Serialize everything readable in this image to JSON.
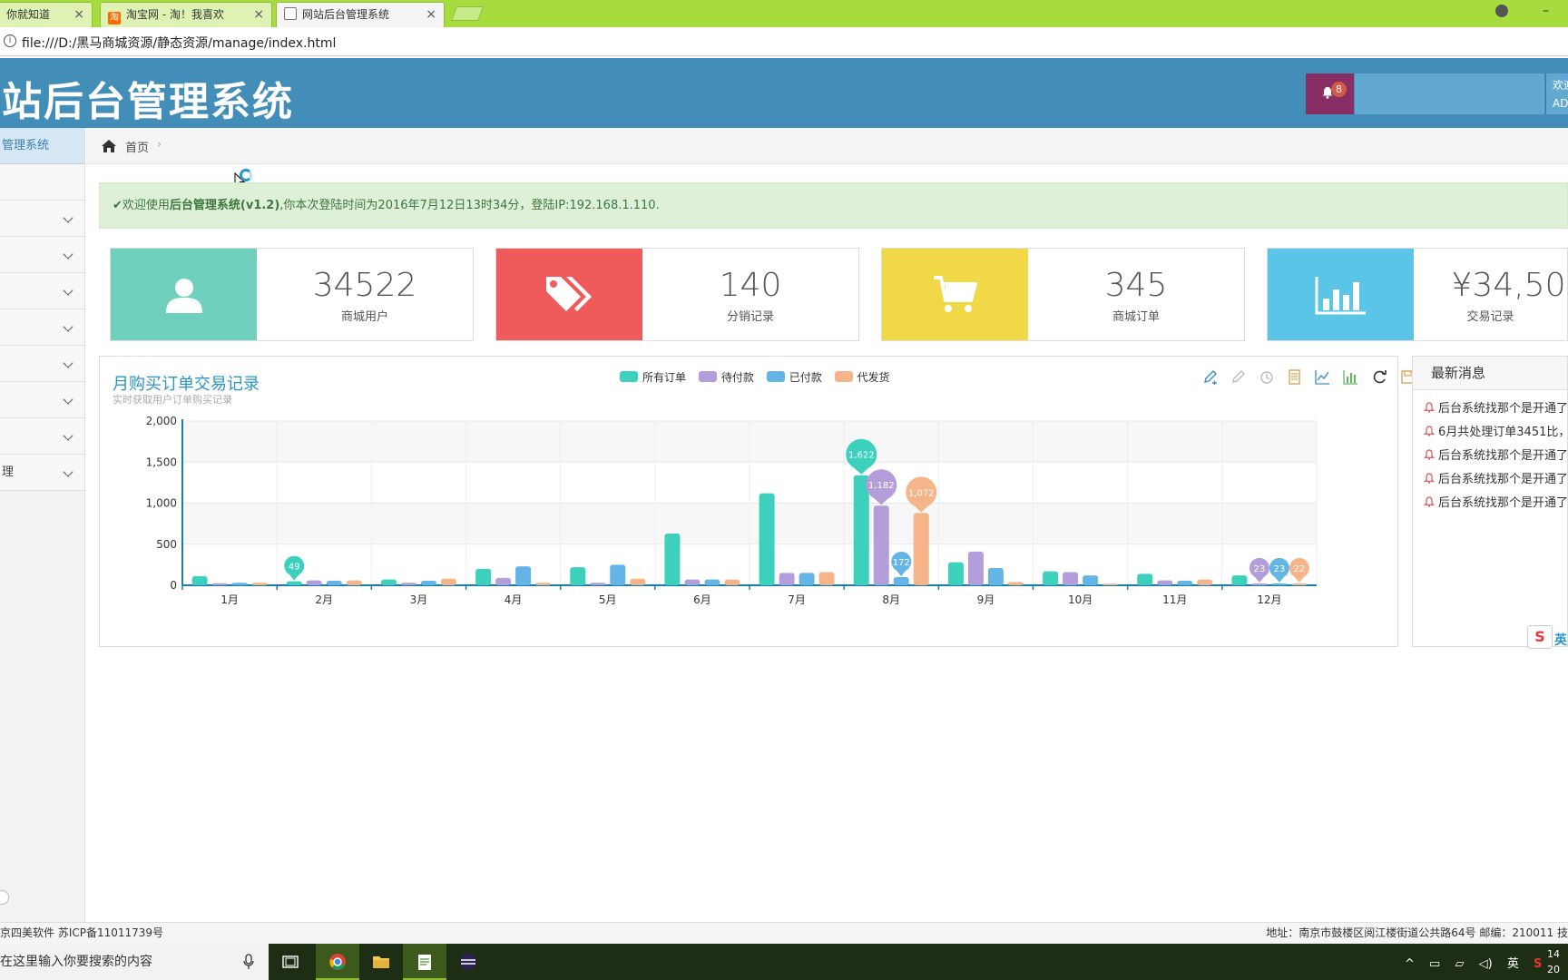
{
  "browser": {
    "tabs": [
      {
        "label": "你就知道",
        "fav_color": "#ffffff"
      },
      {
        "label": "淘宝网 - 淘！我喜欢",
        "fav_color": "#ff6a00",
        "fav_text": "淘"
      },
      {
        "label": "网站后台管理系统",
        "fav_color": "#ffffff"
      }
    ],
    "url": "file:///D:/黑马商城资源/静态资源/manage/index.html"
  },
  "header": {
    "title": "站后台管理系统",
    "notification_count": "8",
    "user_line1": "欢迎",
    "user_line2": "AD"
  },
  "sidebar": {
    "head": "管理系统",
    "last_item_label": "理"
  },
  "breadcrumb": {
    "home": "首页",
    "separator": "›"
  },
  "alert": {
    "prefix": "✔欢迎使用",
    "bold": "后台管理系统(v1.2)",
    "suffix": ",你本次登陆时间为2016年7月12日13时34分，登陆IP:192.168.1.110."
  },
  "stats": [
    {
      "value": "34522",
      "label": "商城用户",
      "color": "#6fd1bd",
      "icon": "user-icon"
    },
    {
      "value": "140",
      "label": "分销记录",
      "color": "#ef5b5b",
      "icon": "tags-icon"
    },
    {
      "value": "345",
      "label": "商城订单",
      "color": "#f0d846",
      "icon": "cart-icon"
    },
    {
      "value": "¥34,50",
      "label": "交易记录",
      "color": "#5bc5e8",
      "icon": "bar-chart-icon"
    }
  ],
  "chart_data": {
    "type": "bar",
    "title": "月购买订单交易记录",
    "subtitle": "实时获取用户订单购买记录",
    "categories": [
      "1月",
      "2月",
      "3月",
      "4月",
      "5月",
      "6月",
      "7月",
      "8月",
      "9月",
      "10月",
      "11月",
      "12月"
    ],
    "ylim": [
      0,
      2000
    ],
    "yticks": [
      0,
      500,
      1000,
      1500,
      2000
    ],
    "series": [
      {
        "name": "所有订单",
        "color": "#3dd0bd",
        "values": [
          110,
          49,
          70,
          200,
          220,
          630,
          1120,
          1340,
          280,
          170,
          140,
          120
        ]
      },
      {
        "name": "待付款",
        "color": "#b39ddb",
        "values": [
          25,
          60,
          30,
          90,
          30,
          70,
          150,
          970,
          410,
          160,
          60,
          23
        ]
      },
      {
        "name": "已付款",
        "color": "#64b5e6",
        "values": [
          30,
          55,
          55,
          230,
          250,
          70,
          150,
          100,
          210,
          120,
          55,
          23
        ]
      },
      {
        "name": "代发货",
        "color": "#f5b48a",
        "values": [
          30,
          60,
          80,
          30,
          80,
          70,
          160,
          880,
          40,
          20,
          70,
          22
        ]
      }
    ],
    "markers": [
      {
        "category": "2月",
        "series": 0,
        "label": "49"
      },
      {
        "category": "8月",
        "series": 0,
        "label": "1,622"
      },
      {
        "category": "8月",
        "series": 1,
        "label": "1,182"
      },
      {
        "category": "8月",
        "series": 2,
        "label": "172"
      },
      {
        "category": "8月",
        "series": 3,
        "label": "1,072"
      },
      {
        "category": "12月",
        "series": 1,
        "label": "23"
      },
      {
        "category": "12月",
        "series": 2,
        "label": "23"
      },
      {
        "category": "12月",
        "series": 3,
        "label": "22"
      }
    ],
    "legend_position": "top-center",
    "grid": true
  },
  "toolbox_icons": [
    "pencil-icon",
    "eraser-icon",
    "magic-icon",
    "data-view-icon",
    "line-chart-icon",
    "bar-chart-icon",
    "refresh-icon",
    "save-icon"
  ],
  "messages": {
    "title": "最新消息",
    "items": [
      "后台系统找那个是开通了",
      "6月共处理订单3451比，",
      "后台系统找那个是开通了",
      "后台系统找那个是开通了",
      "后台系统找那个是开通了"
    ]
  },
  "ime": {
    "logo": "S",
    "text": "英"
  },
  "footer": {
    "left": "京四美软件  苏ICP备11011739号",
    "right": "地址：南京市鼓楼区阅江楼街道公共路64号  邮编：210011  技"
  },
  "taskbar": {
    "search_placeholder": "在这里输入你要搜索的内容",
    "tray_lang": "英",
    "clock_line1": "14",
    "clock_line2": "20"
  }
}
